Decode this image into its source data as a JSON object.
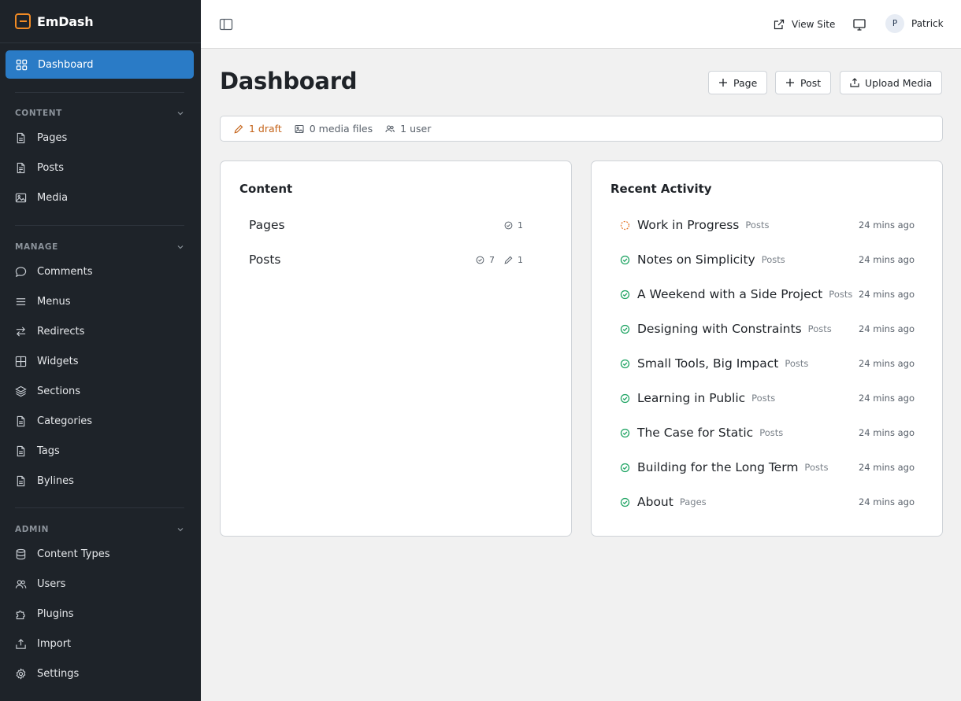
{
  "brand": {
    "name": "EmDash"
  },
  "sidebar": {
    "dashboard_label": "Dashboard",
    "sections": {
      "content": "CONTENT",
      "manage": "MANAGE",
      "admin": "ADMIN"
    },
    "items": {
      "pages": "Pages",
      "posts": "Posts",
      "media": "Media",
      "comments": "Comments",
      "menus": "Menus",
      "redirects": "Redirects",
      "widgets": "Widgets",
      "sections": "Sections",
      "categories": "Categories",
      "tags": "Tags",
      "bylines": "Bylines",
      "content_types": "Content Types",
      "users": "Users",
      "plugins": "Plugins",
      "import": "Import",
      "settings": "Settings"
    }
  },
  "topbar": {
    "view_site": "View Site",
    "user_initial": "P",
    "user_name": "Patrick"
  },
  "main": {
    "title": "Dashboard",
    "actions": {
      "page": "Page",
      "post": "Post",
      "upload": "Upload Media"
    },
    "stats": {
      "drafts": "1 draft",
      "media": "0 media files",
      "users": "1 user"
    }
  },
  "content_card": {
    "title": "Content",
    "rows": [
      {
        "name": "Pages",
        "published": "1"
      },
      {
        "name": "Posts",
        "published": "7",
        "drafts": "1"
      }
    ]
  },
  "activity": {
    "title": "Recent Activity",
    "items": [
      {
        "title": "Work in Progress",
        "type": "Posts",
        "time": "24 mins ago",
        "status": "draft"
      },
      {
        "title": "Notes on Simplicity",
        "type": "Posts",
        "time": "24 mins ago",
        "status": "published"
      },
      {
        "title": "A Weekend with a Side Project",
        "type": "Posts",
        "time": "24 mins ago",
        "status": "published"
      },
      {
        "title": "Designing with Constraints",
        "type": "Posts",
        "time": "24 mins ago",
        "status": "published"
      },
      {
        "title": "Small Tools, Big Impact",
        "type": "Posts",
        "time": "24 mins ago",
        "status": "published"
      },
      {
        "title": "Learning in Public",
        "type": "Posts",
        "time": "24 mins ago",
        "status": "published"
      },
      {
        "title": "The Case for Static",
        "type": "Posts",
        "time": "24 mins ago",
        "status": "published"
      },
      {
        "title": "Building for the Long Term",
        "type": "Posts",
        "time": "24 mins ago",
        "status": "published"
      },
      {
        "title": "About",
        "type": "Pages",
        "time": "24 mins ago",
        "status": "published"
      }
    ]
  },
  "colors": {
    "sidebar_bg": "#1e2329",
    "accent": "#2a7bc6",
    "brand": "#f08a24",
    "published": "#1fa463",
    "draft": "#e5772a"
  }
}
